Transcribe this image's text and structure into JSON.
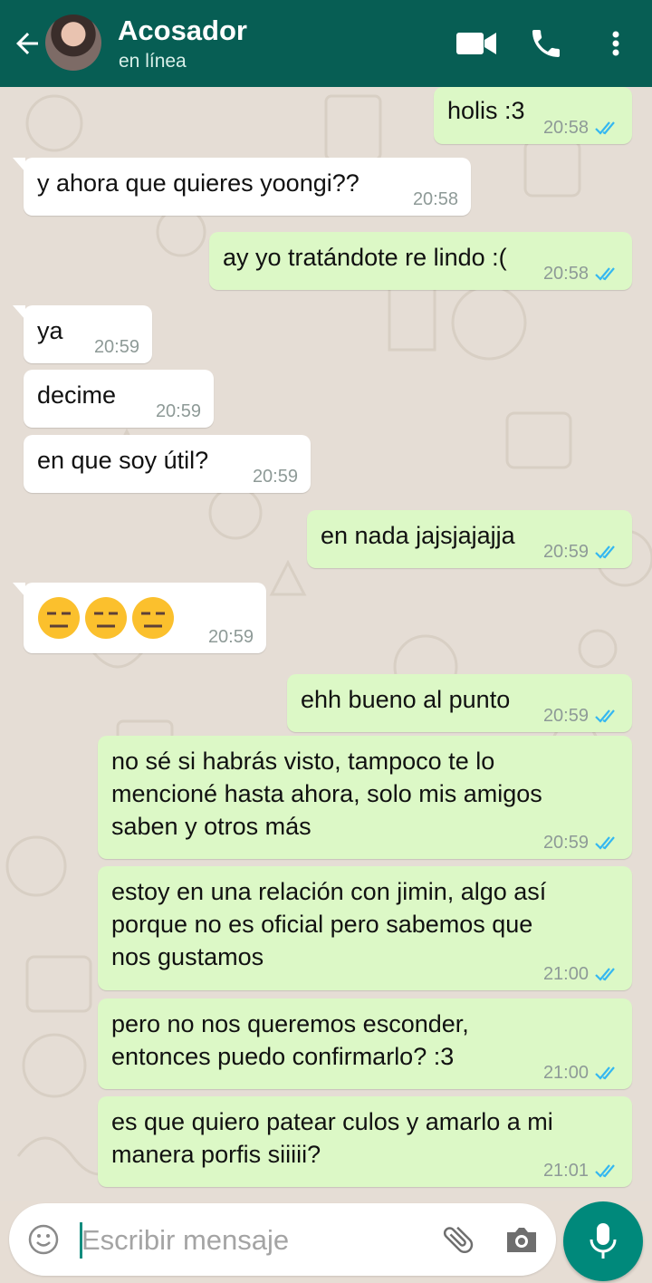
{
  "header": {
    "contact_name": "Acosador",
    "status": "en línea",
    "icons": [
      "back-arrow-icon",
      "video-call-icon",
      "voice-call-icon",
      "more-options-icon"
    ]
  },
  "messages": [
    {
      "direction": "out",
      "text": "holis :3",
      "time": "20:58",
      "ticks": "read"
    },
    {
      "direction": "in",
      "text": "y ahora que quieres yoongi??",
      "time": "20:58"
    },
    {
      "direction": "out",
      "text": "ay yo tratándote re lindo :(",
      "time": "20:58",
      "ticks": "read"
    },
    {
      "direction": "in",
      "text": "ya",
      "time": "20:59"
    },
    {
      "direction": "in",
      "text": "decime",
      "time": "20:59"
    },
    {
      "direction": "in",
      "text": "en que soy útil?",
      "time": "20:59"
    },
    {
      "direction": "out",
      "text": "en nada jajsjajajja",
      "time": "20:59",
      "ticks": "read"
    },
    {
      "direction": "in",
      "text": "😑😑😑",
      "time": "20:59"
    },
    {
      "direction": "out",
      "text": "ehh bueno al punto",
      "time": "20:59",
      "ticks": "read"
    },
    {
      "direction": "out",
      "text": "no sé si habrás visto, tampoco te lo\nmencioné hasta ahora, solo mis amigos\nsaben y otros más",
      "time": "20:59",
      "ticks": "read"
    },
    {
      "direction": "out",
      "text": "estoy en una relación con jimin, algo así\nporque no es oficial pero sabemos que\nnos gustamos",
      "time": "21:00",
      "ticks": "read"
    },
    {
      "direction": "out",
      "text": "pero no nos queremos esconder,\nentonces puedo confirmarlo? :3",
      "time": "21:00",
      "ticks": "read"
    },
    {
      "direction": "out",
      "text": "es que quiero patear culos y amarlo a mi\nmanera porfis siiiii?",
      "time": "21:01",
      "ticks": "read"
    }
  ],
  "composer": {
    "placeholder": "Escribir mensaje",
    "icons": [
      "emoji-icon",
      "attach-icon",
      "camera-icon",
      "mic-icon"
    ]
  },
  "colors": {
    "header": "#075e54",
    "outgoing_bubble": "#dcf8c6",
    "incoming_bubble": "#ffffff",
    "read_ticks": "#34b7f1",
    "mic_button": "#00897b"
  }
}
